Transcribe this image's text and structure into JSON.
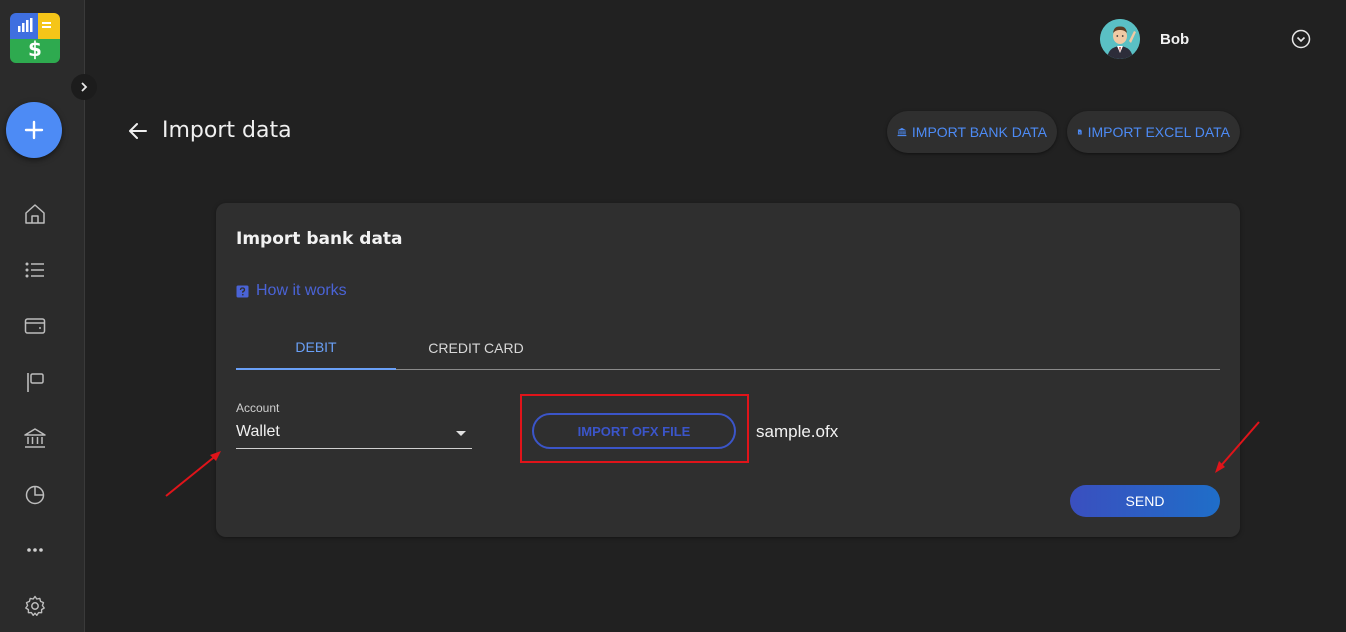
{
  "colors": {
    "accent": "#4d8bf5",
    "link": "#4a63d6",
    "background": "#212121",
    "card": "#2f2f2f",
    "annotation": "#e0141a"
  },
  "sidebar": {
    "logo_symbol": "$",
    "items": [
      {
        "icon": "home-icon"
      },
      {
        "icon": "list-icon"
      },
      {
        "icon": "wallet-icon"
      },
      {
        "icon": "flag-icon"
      },
      {
        "icon": "bank-icon"
      },
      {
        "icon": "pie-chart-icon"
      },
      {
        "icon": "more-icon"
      },
      {
        "icon": "settings-icon"
      }
    ]
  },
  "header": {
    "user_name": "Bob"
  },
  "page": {
    "title": "Import data",
    "import_bank_label": "IMPORT BANK DATA",
    "import_excel_label": "IMPORT EXCEL DATA"
  },
  "card": {
    "title": "Import bank data",
    "how_it_works": "How it works",
    "tabs": [
      {
        "label": "DEBIT",
        "active": true
      },
      {
        "label": "CREDIT CARD",
        "active": false
      }
    ],
    "account": {
      "label": "Account",
      "value": "Wallet"
    },
    "import_ofx_label": "IMPORT OFX FILE",
    "file_name": "sample.ofx",
    "send_label": "SEND"
  }
}
